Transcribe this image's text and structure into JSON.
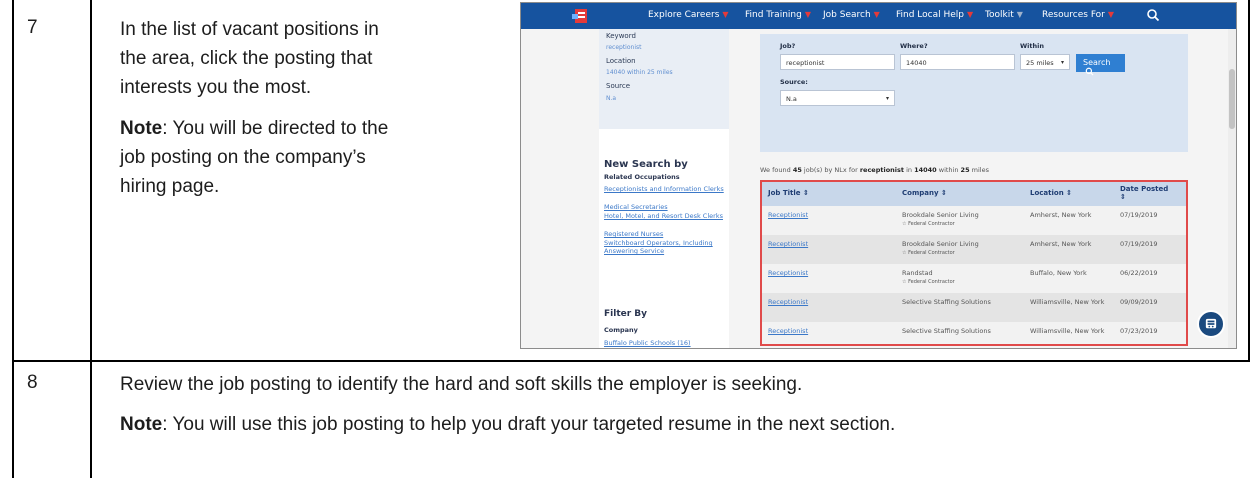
{
  "rows": [
    {
      "number": "7",
      "instruction": "In the list of vacant positions in the area, click the posting that interests you the most.",
      "note_label": "Note",
      "note_text": ": You will be directed to the job posting on the company’s hiring page."
    },
    {
      "number": "8",
      "instruction": "Review the job posting to identify the hard and soft skills the employer is seeking.",
      "note_label": "Note",
      "note_text": ": You will use this job posting to help you draft your targeted resume in the next section."
    }
  ],
  "screenshot": {
    "nav": [
      {
        "label": "Explore Careers",
        "arrow": "▼"
      },
      {
        "label": "Find Training",
        "arrow": "▼"
      },
      {
        "label": "Job Search",
        "arrow": "▼"
      },
      {
        "label": "Find Local Help",
        "arrow": "▼"
      },
      {
        "label": "Toolkit",
        "arrow": "▼"
      },
      {
        "label": "Resources For",
        "arrow": "▼"
      }
    ],
    "sidebar": {
      "keyword_label": "Keyword",
      "keyword_value": "receptionist",
      "location_label": "Location",
      "location_value": "14040 within 25 miles",
      "source_label": "Source",
      "source_value": "N.a",
      "new_search_heading": "New Search by",
      "related_label": "Related Occupations",
      "occupations": [
        "Receptionists and Information Clerks",
        "Medical Secretaries",
        "Hotel, Motel, and Resort Desk Clerks",
        "Registered Nurses",
        "Switchboard Operators, Including Answering Service"
      ],
      "filter_heading": "Filter By",
      "company_label": "Company",
      "company_value": "Buffalo Public Schools (16)"
    },
    "search": {
      "job_label": "Job?",
      "job_value": "receptionist",
      "where_label": "Where?",
      "where_value": "14040",
      "within_label": "Within",
      "within_value": "25 miles",
      "source_label": "Source:",
      "source_value": "N.a",
      "search_button": "Search",
      "found_prefix": "We found ",
      "found_count": "45",
      "found_mid": " job(s) by ",
      "found_by": "NLx",
      "found_for": " for ",
      "found_keyword": "receptionist",
      "found_in": " in ",
      "found_zip": "14040",
      "found_within": " within ",
      "found_miles": "25",
      "found_suffix": " miles"
    },
    "table": {
      "headers": [
        "Job Title ⇕",
        "Company ⇕",
        "Location ⇕",
        "Date Posted ⇕"
      ],
      "rows": [
        {
          "title": "Receptionist",
          "company": "Brookdale Senior Living",
          "federal": "Federal Contractor",
          "location": "Amherst, New York",
          "date": "07/19/2019"
        },
        {
          "title": "Receptionist",
          "company": "Brookdale Senior Living",
          "federal": "Federal Contractor",
          "location": "Amherst, New York",
          "date": "07/19/2019"
        },
        {
          "title": "Receptionist",
          "company": "Randstad",
          "federal": "Federal Contractor",
          "location": "Buffalo, New York",
          "date": "06/22/2019"
        },
        {
          "title": "Receptionist",
          "company": "Selective Staffing Solutions",
          "federal": "",
          "location": "Williamsville, New York",
          "date": "09/09/2019"
        },
        {
          "title": "Receptionist",
          "company": "Selective Staffing Solutions",
          "federal": "",
          "location": "Williamsville, New York",
          "date": "07/23/2019"
        }
      ]
    }
  },
  "colors": {
    "nav_bg": "#16539f",
    "highlight_border": "#e04a4a",
    "link": "#3b78c8",
    "search_button": "#2f7fd2"
  }
}
